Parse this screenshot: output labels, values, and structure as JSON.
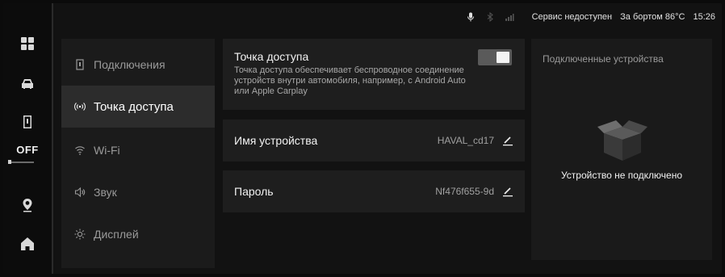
{
  "status_bar": {
    "icons": [
      "mic-icon",
      "bluetooth-icon",
      "signal-icon"
    ],
    "service": "Сервис недоступен",
    "outside_temp": "За бортом 86°C",
    "time": "15:26"
  },
  "rail": {
    "items": [
      "apps-icon",
      "car-icon",
      "phone-icon",
      "location-icon",
      "home-icon"
    ],
    "off_label": "OFF"
  },
  "menu": {
    "items": [
      {
        "label": "Подключения",
        "icon": "phone-icon"
      },
      {
        "label": "Точка доступа",
        "icon": "hotspot-icon",
        "active": true
      },
      {
        "label": "Wi-Fi",
        "icon": "wifi-icon"
      },
      {
        "label": "Звук",
        "icon": "sound-icon"
      },
      {
        "label": "Дисплей",
        "icon": "brightness-icon"
      }
    ]
  },
  "hotspot": {
    "title": "Точка доступа",
    "description": "Точка доступа обеспечивает беспроводное соединение устройств внутри автомобиля, например, с Android Auto или Apple Carplay",
    "enabled": true
  },
  "device_name": {
    "label": "Имя устройства",
    "value": "HAVAL_cd17"
  },
  "password": {
    "label": "Пароль",
    "value": "Nf476f655-9d"
  },
  "devices": {
    "title": "Подключенные устройства",
    "empty_text": "Устройство не подключено"
  },
  "colors": {
    "background": "#121212",
    "panel": "#1e1e1e",
    "active_item": "#2c2c2c",
    "text": "#f2f2f2",
    "muted_text": "#a0a0a0"
  }
}
